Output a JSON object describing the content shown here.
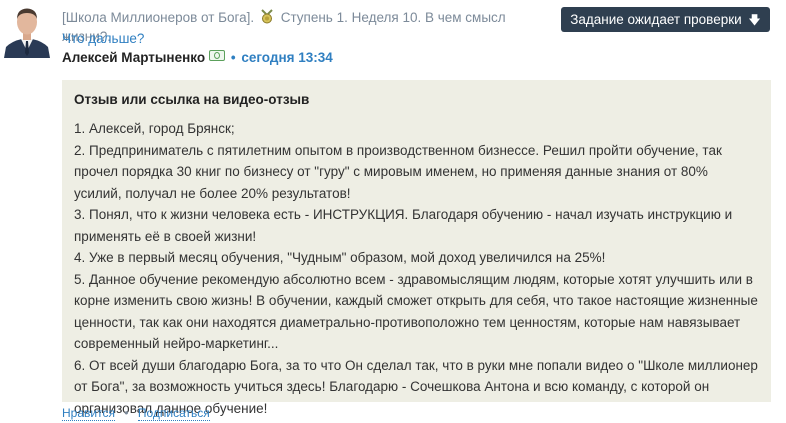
{
  "post": {
    "breadcrumb": {
      "title": "[Школа Миллионеров от Бога].",
      "course_icon": "medal-badge-icon",
      "step": "Ступень 1. Неделя 10. В чем смысл жизни?."
    },
    "what_next": "Что дальше?",
    "author": {
      "name": "Алексей Мартыненко",
      "badge_icon": "money-icon",
      "separator": "•",
      "date": "сегодня 13:34"
    },
    "status_button": {
      "label": "Задание ожидает проверки",
      "icon": "arrow-down-icon",
      "icon_glyph": "🡇"
    }
  },
  "content": {
    "title": "Отзыв или ссылка на видео-отзыв",
    "paragraphs": [
      "1. Алексей, город Брянск;",
      "2. Предприниматель с пятилетним опытом в производственном бизнессе. Решил пройти обучение, так прочел порядка 30 книг по бизнесу от \"гуру\" с мировым именем, но применяя данные знания от 80% усилий, получал не более 20% результатов!",
      "3. Понял, что к жизни человека есть - ИНСТРУКЦИЯ. Благодаря обучению - начал изучать инструкцию и применять её в своей жизни!",
      "4. Уже в первый месяц обучения, \"Чудным\" образом, мой доход увеличился на 25%!",
      "5. Данное обучение рекомендую абсолютно всем - здравомыслящим людям, которые хотят улучшить или в корне изменить свою жизнь! В обучении, каждый сможет открыть для себя, что такое настоящие жизненные ценности, так как они находятся диаметрально-противоположно тем ценностям, которые нам навязывает современный нейро-маркетинг...",
      "6. От всей души благодарю Бога, за то что Он сделал так, что в руки мне попали видео о \"Школе миллионер от Бога\", за возможность учиться здесь! Благодарю - Сочешкова Антона и всю команду, с которой он организовал данное обучение!"
    ]
  },
  "footer": {
    "like_label": "Нравится",
    "separator": "•",
    "subscribe_label": "Подписаться"
  },
  "colors": {
    "link": "#2f7fc1",
    "muted": "#7c8a99",
    "button_bg": "#2f3f50",
    "content_bg": "#eeeee4"
  }
}
